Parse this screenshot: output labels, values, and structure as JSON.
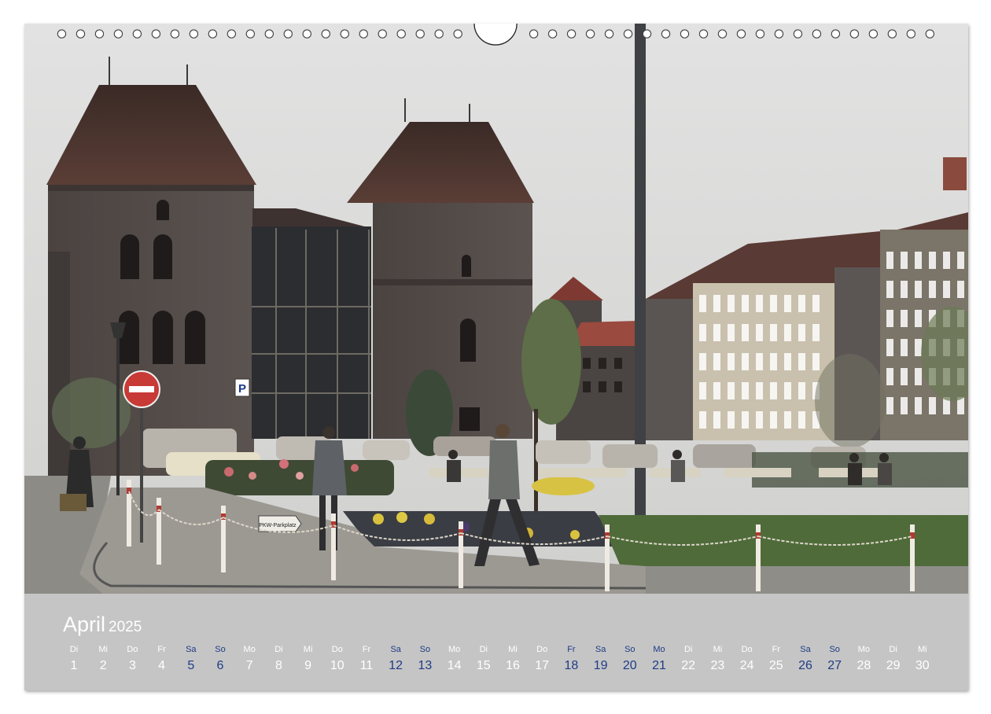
{
  "calendar": {
    "month": "April",
    "year": "2025",
    "colors": {
      "weekday": "#ffffff",
      "weekend_holiday": "#1f3c86",
      "band": "#c5c5c5"
    },
    "days": [
      {
        "wd": "Di",
        "d": "1",
        "we": false
      },
      {
        "wd": "Mi",
        "d": "2",
        "we": false
      },
      {
        "wd": "Do",
        "d": "3",
        "we": false
      },
      {
        "wd": "Fr",
        "d": "4",
        "we": false
      },
      {
        "wd": "Sa",
        "d": "5",
        "we": true
      },
      {
        "wd": "So",
        "d": "6",
        "we": true
      },
      {
        "wd": "Mo",
        "d": "7",
        "we": false
      },
      {
        "wd": "Di",
        "d": "8",
        "we": false
      },
      {
        "wd": "Mi",
        "d": "9",
        "we": false
      },
      {
        "wd": "Do",
        "d": "10",
        "we": false
      },
      {
        "wd": "Fr",
        "d": "11",
        "we": false
      },
      {
        "wd": "Sa",
        "d": "12",
        "we": true
      },
      {
        "wd": "So",
        "d": "13",
        "we": true
      },
      {
        "wd": "Mo",
        "d": "14",
        "we": false
      },
      {
        "wd": "Di",
        "d": "15",
        "we": false
      },
      {
        "wd": "Mi",
        "d": "16",
        "we": false
      },
      {
        "wd": "Do",
        "d": "17",
        "we": false
      },
      {
        "wd": "Fr",
        "d": "18",
        "we": true
      },
      {
        "wd": "Sa",
        "d": "19",
        "we": true
      },
      {
        "wd": "So",
        "d": "20",
        "we": true
      },
      {
        "wd": "Mo",
        "d": "21",
        "we": true
      },
      {
        "wd": "Di",
        "d": "22",
        "we": false
      },
      {
        "wd": "Mi",
        "d": "23",
        "we": false
      },
      {
        "wd": "Do",
        "d": "24",
        "we": false
      },
      {
        "wd": "Fr",
        "d": "25",
        "we": false
      },
      {
        "wd": "Sa",
        "d": "26",
        "we": true
      },
      {
        "wd": "So",
        "d": "27",
        "we": true
      },
      {
        "wd": "Mo",
        "d": "28",
        "we": false
      },
      {
        "wd": "Di",
        "d": "29",
        "we": false
      },
      {
        "wd": "Mi",
        "d": "30",
        "we": false
      }
    ]
  },
  "photo": {
    "signs": {
      "parking": "P",
      "direction_sign": "PKW-Parkplatz"
    }
  }
}
